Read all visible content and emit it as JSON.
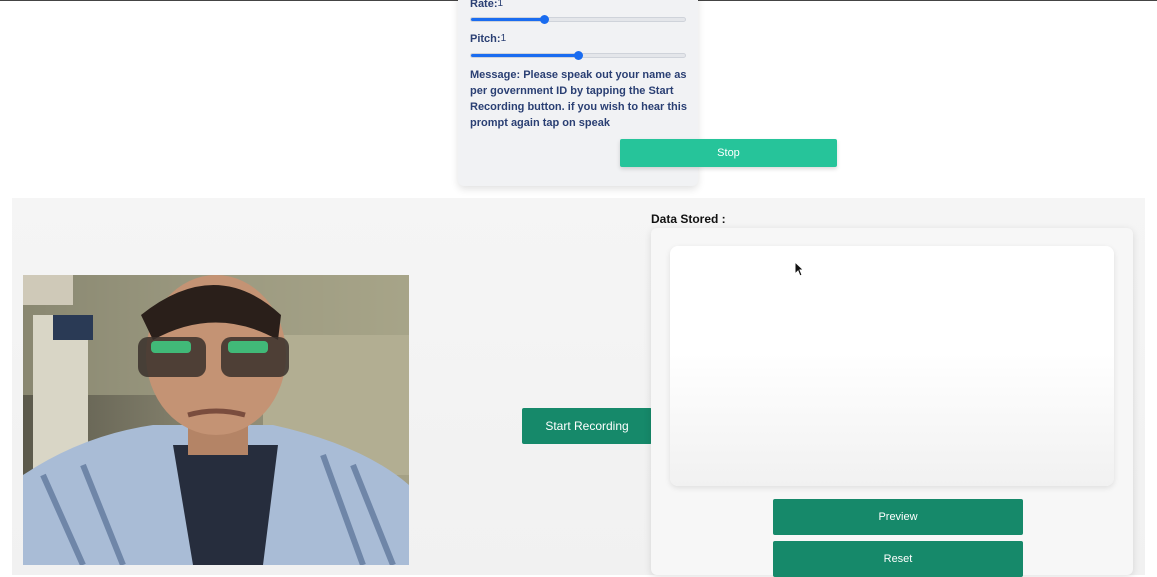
{
  "voice_settings": {
    "rate_label": "Rate:",
    "rate_value": "1",
    "rate_level": 0.34,
    "pitch_label": "Pitch:",
    "pitch_value": "1",
    "pitch_level": 0.5,
    "message": "Message: Please speak out your name as per government ID by tapping the Start Recording button. if you wish to hear this prompt again tap on speak",
    "stop_label": "Stop"
  },
  "recorder": {
    "start_label": "Start Recording",
    "data_title": "Data Stored :",
    "preview_label": "Preview",
    "reset_label": "Reset"
  },
  "colors": {
    "accent_teal": "#26c49a",
    "button_green": "#16896a",
    "slider_blue": "#1a6cf0",
    "text_navy": "#2a3f73"
  },
  "icons": {
    "cursor": "mouse-pointer-icon"
  }
}
